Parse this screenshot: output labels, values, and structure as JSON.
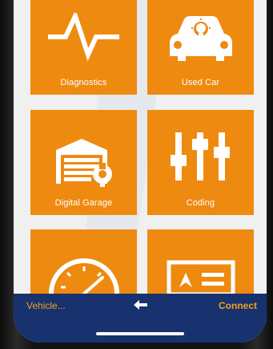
{
  "tiles": [
    {
      "label": "Diagnostics",
      "icon": "heartbeat-icon"
    },
    {
      "label": "Used Car",
      "icon": "car-lightbulb-icon"
    },
    {
      "label": "Digital Garage",
      "icon": "garage-wrench-icon"
    },
    {
      "label": "Coding",
      "icon": "sliders-icon"
    },
    {
      "label": "",
      "icon": "speedometer-icon"
    },
    {
      "label": "",
      "icon": "id-card-icon"
    }
  ],
  "bottom_bar": {
    "left_label": "Vehicle...",
    "back_icon": "back-arrow-icon",
    "right_label": "Connect"
  },
  "colors": {
    "tile_orange": "#ee8a10",
    "bar_blue": "#17326e",
    "bar_text_orange": "#f0a21e"
  }
}
